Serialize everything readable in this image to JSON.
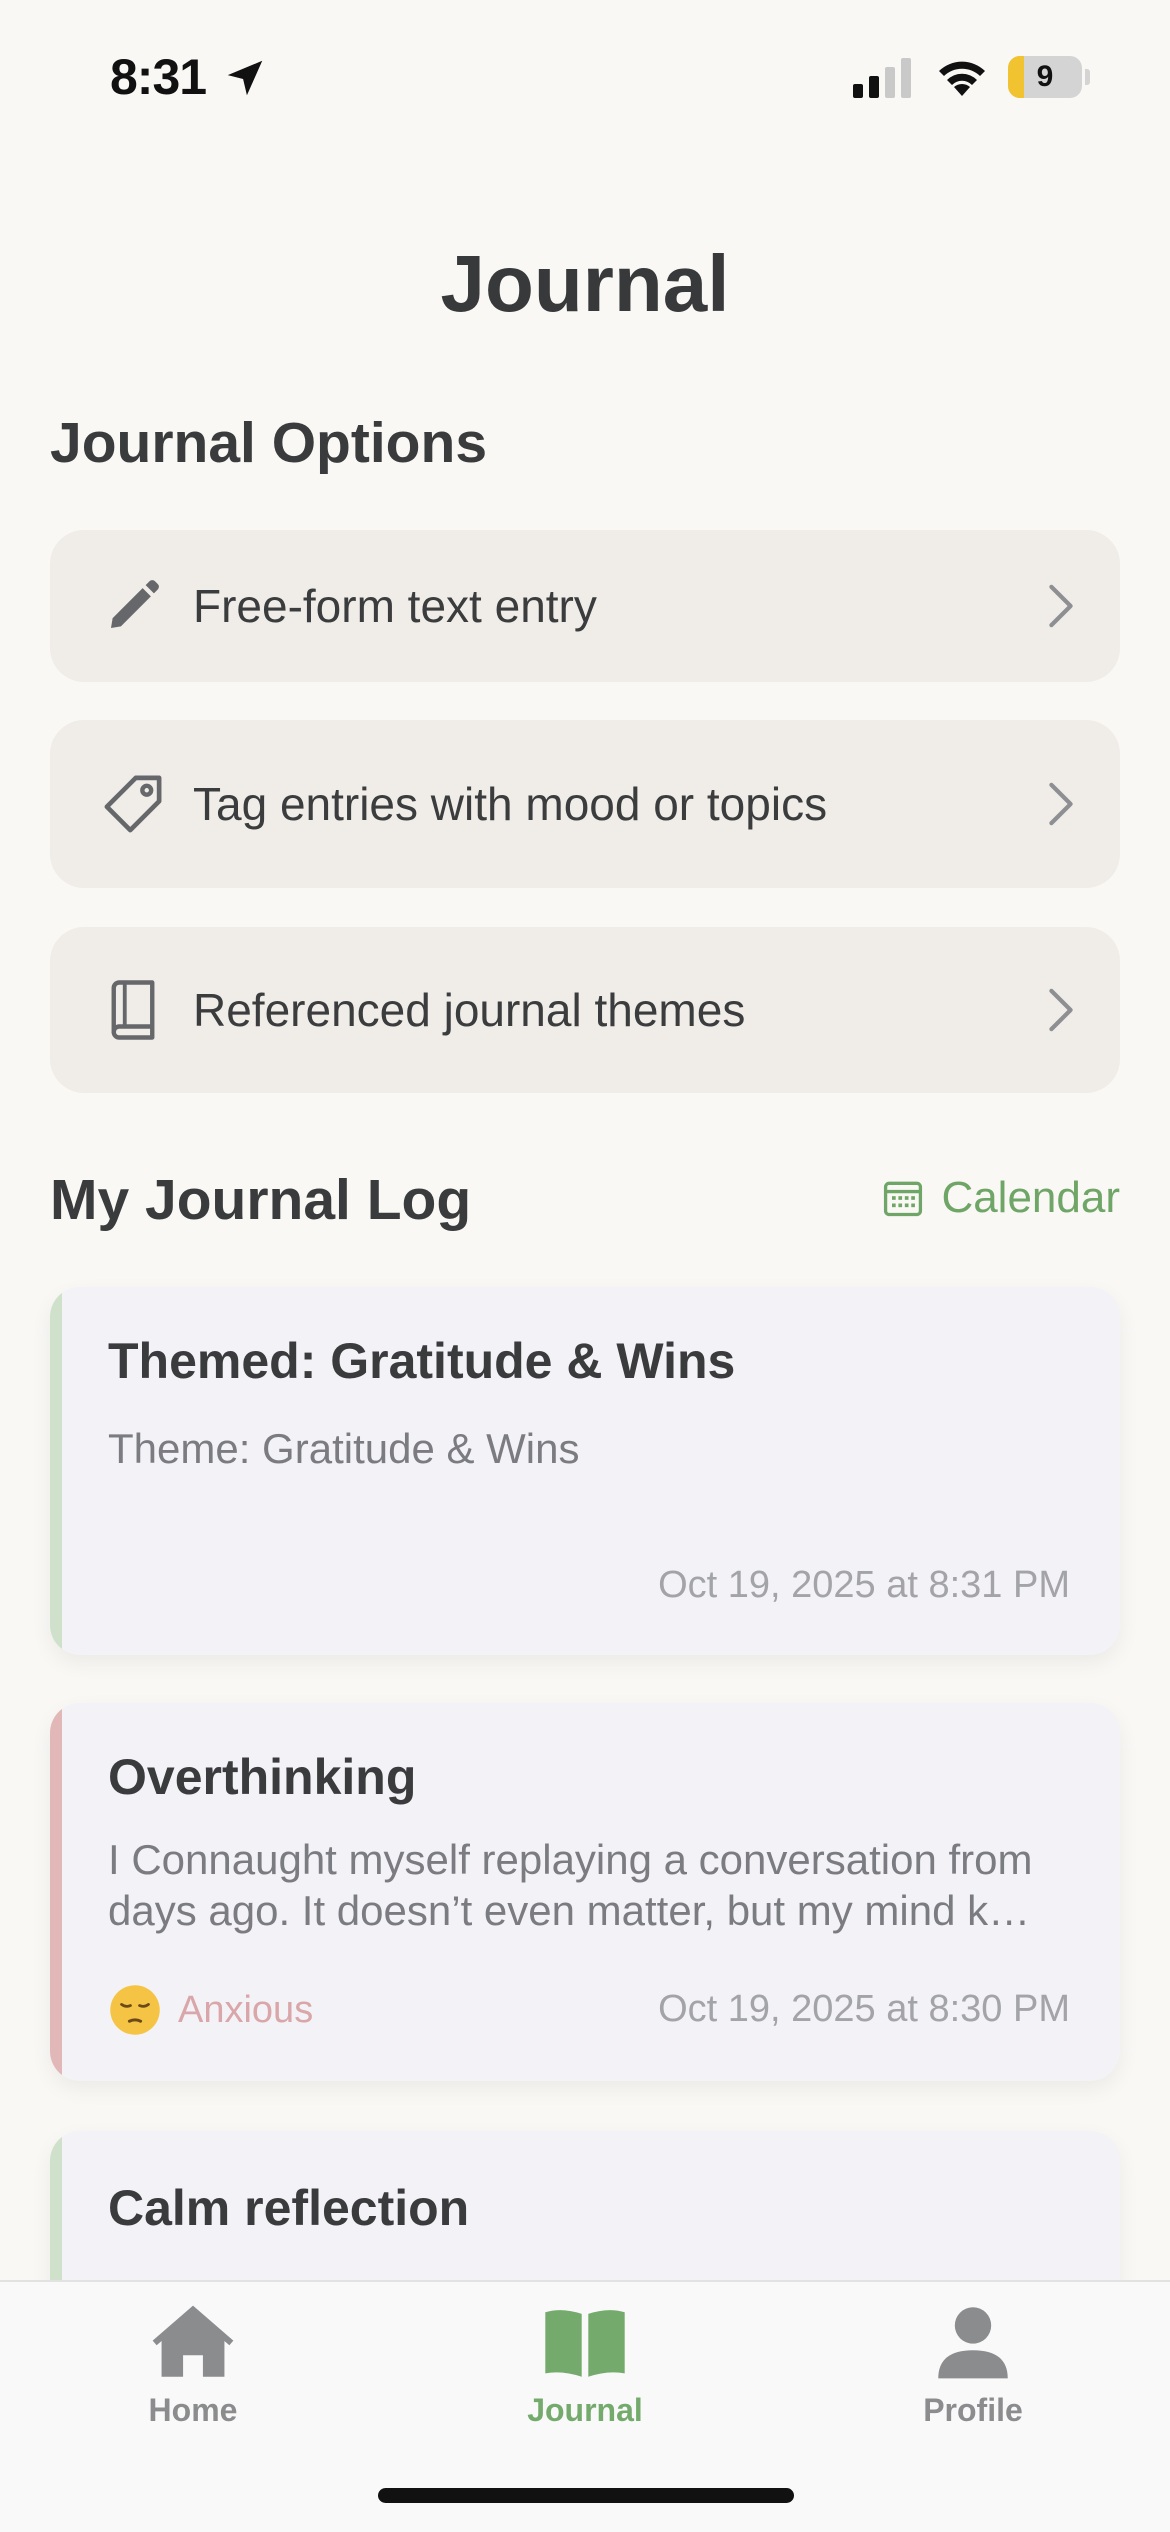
{
  "status_bar": {
    "time": "8:31",
    "battery": "9",
    "battery_level": 0.09
  },
  "header": {
    "title": "Journal"
  },
  "options": {
    "title": "Journal Options",
    "items": [
      {
        "label": "Free-form text entry",
        "icon": "pencil-icon"
      },
      {
        "label": "Tag entries with mood or topics",
        "icon": "tag-icon"
      },
      {
        "label": "Referenced journal themes",
        "icon": "book-icon"
      }
    ]
  },
  "log": {
    "title": "My Journal Log",
    "calendar_label": "Calendar",
    "entries": [
      {
        "title": "Themed: Gratitude & Wins",
        "body": "Theme: Gratitude & Wins",
        "date": "Oct 19, 2025 at 8:31 PM",
        "accent": "#cfe1cb"
      },
      {
        "title": "Overthinking",
        "body": "I Connaught myself replaying a conversation from days ago. It doesn’t even matter, but my mind k…",
        "mood": "Anxious",
        "mood_icon": "pensive-face-icon",
        "date": "Oct 19, 2025 at 8:30 PM",
        "accent": "#e2b7b8"
      },
      {
        "title": "Calm reflection",
        "accent": "#cfe1cb"
      }
    ]
  },
  "tabs": [
    {
      "label": "Home",
      "icon": "home-icon",
      "active": false
    },
    {
      "label": "Journal",
      "icon": "open-book-icon",
      "active": true
    },
    {
      "label": "Profile",
      "icon": "person-icon",
      "active": false
    }
  ],
  "colors": {
    "accent_green": "#74ab6d",
    "anxious_pink": "#d9a6a9",
    "card_bg": "#f0ede8"
  }
}
